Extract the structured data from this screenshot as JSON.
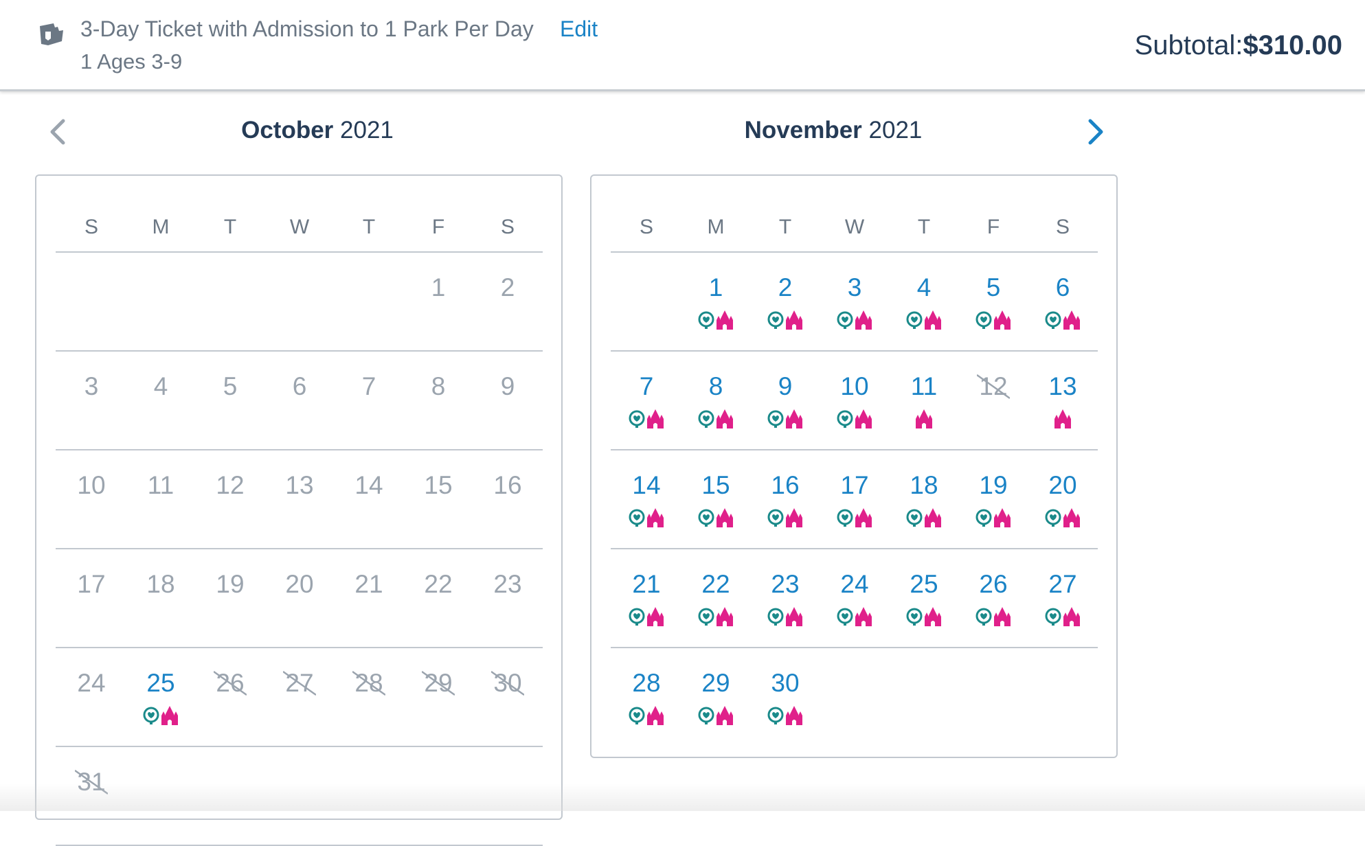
{
  "header": {
    "ticket_name": "3-Day Ticket with Admission to 1 Park Per Day",
    "edit_label": "Edit",
    "guests": "1 Ages 3-9",
    "subtotal_label": "Subtotal:",
    "subtotal_value": "$310.00"
  },
  "nav": {
    "prev_icon": "chevron-left-icon",
    "next_icon": "chevron-right-icon"
  },
  "colors": {
    "available": "#1a83c6",
    "past": "#9ba4ae",
    "park_teal": "#1a8a8a",
    "park_pink": "#e0208a"
  },
  "weekdays": [
    "S",
    "M",
    "T",
    "W",
    "T",
    "F",
    "S"
  ],
  "calendars": [
    {
      "month": "October",
      "year": "2021",
      "first_weekday": 5,
      "days": [
        {
          "d": "1",
          "s": "past"
        },
        {
          "d": "2",
          "s": "past"
        },
        {
          "d": "3",
          "s": "past"
        },
        {
          "d": "4",
          "s": "past"
        },
        {
          "d": "5",
          "s": "past"
        },
        {
          "d": "6",
          "s": "past"
        },
        {
          "d": "7",
          "s": "past"
        },
        {
          "d": "8",
          "s": "past"
        },
        {
          "d": "9",
          "s": "past"
        },
        {
          "d": "10",
          "s": "past"
        },
        {
          "d": "11",
          "s": "past"
        },
        {
          "d": "12",
          "s": "past"
        },
        {
          "d": "13",
          "s": "past"
        },
        {
          "d": "14",
          "s": "past"
        },
        {
          "d": "15",
          "s": "past"
        },
        {
          "d": "16",
          "s": "past"
        },
        {
          "d": "17",
          "s": "past"
        },
        {
          "d": "18",
          "s": "past"
        },
        {
          "d": "19",
          "s": "past"
        },
        {
          "d": "20",
          "s": "past"
        },
        {
          "d": "21",
          "s": "past"
        },
        {
          "d": "22",
          "s": "past"
        },
        {
          "d": "23",
          "s": "past"
        },
        {
          "d": "24",
          "s": "past"
        },
        {
          "d": "25",
          "s": "avail",
          "parks": [
            "epcot",
            "castle"
          ]
        },
        {
          "d": "26",
          "s": "blocked"
        },
        {
          "d": "27",
          "s": "blocked"
        },
        {
          "d": "28",
          "s": "blocked"
        },
        {
          "d": "29",
          "s": "blocked"
        },
        {
          "d": "30",
          "s": "blocked"
        },
        {
          "d": "31",
          "s": "blocked"
        }
      ]
    },
    {
      "month": "November",
      "year": "2021",
      "first_weekday": 1,
      "days": [
        {
          "d": "1",
          "s": "avail",
          "parks": [
            "epcot",
            "castle"
          ]
        },
        {
          "d": "2",
          "s": "avail",
          "parks": [
            "epcot",
            "castle"
          ]
        },
        {
          "d": "3",
          "s": "avail",
          "parks": [
            "epcot",
            "castle"
          ]
        },
        {
          "d": "4",
          "s": "avail",
          "parks": [
            "epcot",
            "castle"
          ]
        },
        {
          "d": "5",
          "s": "avail",
          "parks": [
            "epcot",
            "castle"
          ]
        },
        {
          "d": "6",
          "s": "avail",
          "parks": [
            "epcot",
            "castle"
          ]
        },
        {
          "d": "7",
          "s": "avail",
          "parks": [
            "epcot",
            "castle"
          ]
        },
        {
          "d": "8",
          "s": "avail",
          "parks": [
            "epcot",
            "castle"
          ]
        },
        {
          "d": "9",
          "s": "avail",
          "parks": [
            "epcot",
            "castle"
          ]
        },
        {
          "d": "10",
          "s": "avail",
          "parks": [
            "epcot",
            "castle"
          ]
        },
        {
          "d": "11",
          "s": "avail",
          "parks": [
            "castle"
          ]
        },
        {
          "d": "12",
          "s": "blocked"
        },
        {
          "d": "13",
          "s": "avail",
          "parks": [
            "castle"
          ]
        },
        {
          "d": "14",
          "s": "avail",
          "parks": [
            "epcot",
            "castle"
          ]
        },
        {
          "d": "15",
          "s": "avail",
          "parks": [
            "epcot",
            "castle"
          ]
        },
        {
          "d": "16",
          "s": "avail",
          "parks": [
            "epcot",
            "castle"
          ]
        },
        {
          "d": "17",
          "s": "avail",
          "parks": [
            "epcot",
            "castle"
          ]
        },
        {
          "d": "18",
          "s": "avail",
          "parks": [
            "epcot",
            "castle"
          ]
        },
        {
          "d": "19",
          "s": "avail",
          "parks": [
            "epcot",
            "castle"
          ]
        },
        {
          "d": "20",
          "s": "avail",
          "parks": [
            "epcot",
            "castle"
          ]
        },
        {
          "d": "21",
          "s": "avail",
          "parks": [
            "epcot",
            "castle"
          ]
        },
        {
          "d": "22",
          "s": "avail",
          "parks": [
            "epcot",
            "castle"
          ]
        },
        {
          "d": "23",
          "s": "avail",
          "parks": [
            "epcot",
            "castle"
          ]
        },
        {
          "d": "24",
          "s": "avail",
          "parks": [
            "epcot",
            "castle"
          ]
        },
        {
          "d": "25",
          "s": "avail",
          "parks": [
            "epcot",
            "castle"
          ]
        },
        {
          "d": "26",
          "s": "avail",
          "parks": [
            "epcot",
            "castle"
          ]
        },
        {
          "d": "27",
          "s": "avail",
          "parks": [
            "epcot",
            "castle"
          ]
        },
        {
          "d": "28",
          "s": "avail",
          "parks": [
            "epcot",
            "castle"
          ]
        },
        {
          "d": "29",
          "s": "avail",
          "parks": [
            "epcot",
            "castle"
          ]
        },
        {
          "d": "30",
          "s": "avail",
          "parks": [
            "epcot",
            "castle"
          ]
        }
      ]
    }
  ]
}
